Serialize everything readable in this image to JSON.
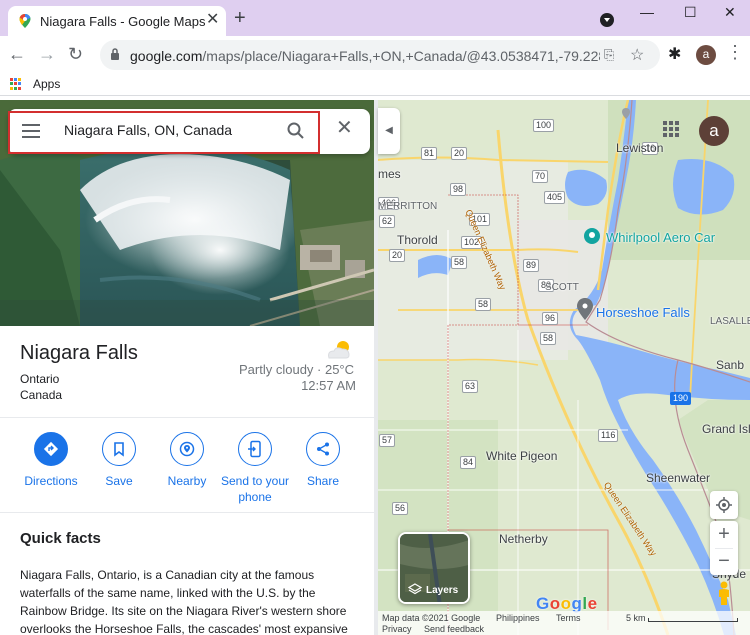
{
  "browser": {
    "tab_title": "Niagara Falls - Google Maps",
    "url_host": "google.com",
    "url_path": "/maps/place/Niagara+Falls,+ON,+Canada/@43.0538471,-79.2281...",
    "bookmarks_apps_label": "Apps",
    "profile_initial": "a",
    "colors": {
      "tabstrip": "#dfcff0",
      "omnibox": "#f1f3f4"
    }
  },
  "search": {
    "query": "Niagara Falls, ON, Canada"
  },
  "place": {
    "name": "Niagara Falls",
    "region": "Ontario",
    "country": "Canada",
    "weather": "Partly cloudy · 25°C",
    "time": "12:57 AM"
  },
  "actions": [
    {
      "label": "Directions",
      "icon": "directions-icon"
    },
    {
      "label": "Save",
      "icon": "bookmark-icon"
    },
    {
      "label": "Nearby",
      "icon": "nearby-icon"
    },
    {
      "label": "Send to your phone",
      "icon": "phone-icon"
    },
    {
      "label": "Share",
      "icon": "share-icon"
    }
  ],
  "quick_facts": {
    "title": "Quick facts",
    "body": "Niagara Falls, Ontario, is a Canadian city at the famous waterfalls of the same name, linked with the U.S. by the Rainbow Bridge. Its site on the Niagara River's western shore overlooks the Horseshoe Falls, the cascades' most expansive"
  },
  "map": {
    "avatar_initial": "a",
    "layers_label": "Layers",
    "logo": "Google",
    "attribution": "Map data ©2021 Google",
    "links": [
      "Philippines",
      "Terms",
      "Privacy",
      "Send feedback"
    ],
    "scale": "5 km",
    "places": {
      "lewiston": "Lewiston",
      "merritton": "MERRITTON",
      "thorold": "Thorold",
      "whirlpool": "Whirlpool Aero Car",
      "scott": "SCOTT",
      "horseshoe": "Horseshoe Falls",
      "lasalle": "LASALLE",
      "sanborn": "Sanb",
      "grand_island": "Grand Isla",
      "white_pigeon": "White Pigeon",
      "sheenwater": "Sheenwater",
      "netherby": "Netherby",
      "mes": "mes",
      "snyde": "Snyde"
    },
    "roads": {
      "qew_north": "Queen Elizabeth Way",
      "qew_south": "Queen Elizabeth Way"
    },
    "shields": [
      "100",
      "101",
      "102",
      "98",
      "405",
      "406",
      "83",
      "89",
      "81",
      "70",
      "20",
      "20",
      "58",
      "58",
      "58",
      "63",
      "57",
      "56",
      "116",
      "84",
      "96",
      "190",
      "16",
      "62"
    ],
    "colors": {
      "land": "#dfe9d0",
      "water": "#8ab4f8",
      "highway": "#f9d56b",
      "border": "#c5221f"
    }
  }
}
